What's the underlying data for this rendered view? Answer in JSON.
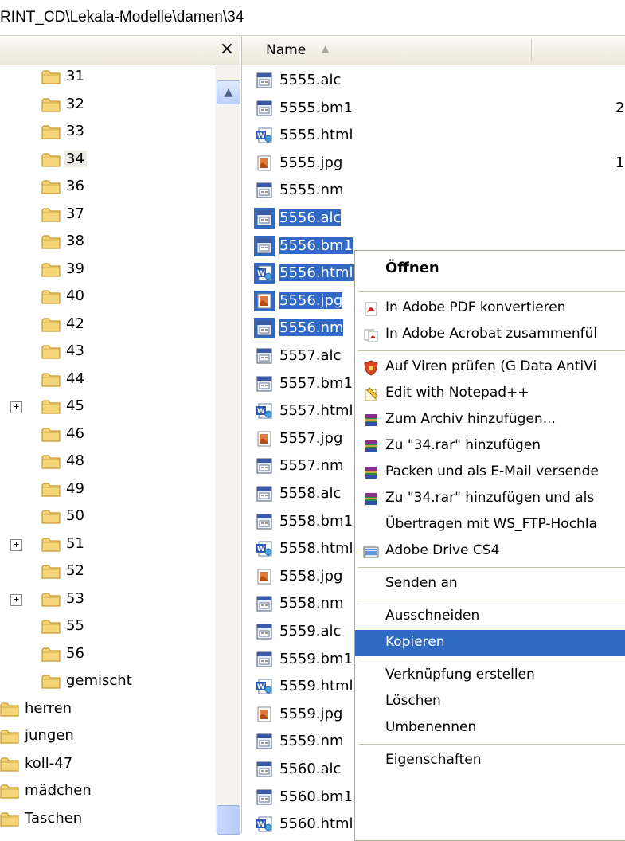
{
  "address": {
    "path": "RINT_CD\\Lekala-Modelle\\damen\\34"
  },
  "folders_pane": {
    "close_label": "×",
    "items": [
      {
        "label": "31",
        "level": 1,
        "expandable": false,
        "selected": false
      },
      {
        "label": "32",
        "level": 1,
        "expandable": false,
        "selected": false
      },
      {
        "label": "33",
        "level": 1,
        "expandable": false,
        "selected": false
      },
      {
        "label": "34",
        "level": 1,
        "expandable": false,
        "selected": true
      },
      {
        "label": "36",
        "level": 1,
        "expandable": false,
        "selected": false
      },
      {
        "label": "37",
        "level": 1,
        "expandable": false,
        "selected": false
      },
      {
        "label": "38",
        "level": 1,
        "expandable": false,
        "selected": false
      },
      {
        "label": "39",
        "level": 1,
        "expandable": false,
        "selected": false
      },
      {
        "label": "40",
        "level": 1,
        "expandable": false,
        "selected": false
      },
      {
        "label": "42",
        "level": 1,
        "expandable": false,
        "selected": false
      },
      {
        "label": "43",
        "level": 1,
        "expandable": false,
        "selected": false
      },
      {
        "label": "44",
        "level": 1,
        "expandable": false,
        "selected": false
      },
      {
        "label": "45",
        "level": 1,
        "expandable": true,
        "selected": false
      },
      {
        "label": "46",
        "level": 1,
        "expandable": false,
        "selected": false
      },
      {
        "label": "48",
        "level": 1,
        "expandable": false,
        "selected": false
      },
      {
        "label": "49",
        "level": 1,
        "expandable": false,
        "selected": false
      },
      {
        "label": "50",
        "level": 1,
        "expandable": false,
        "selected": false
      },
      {
        "label": "51",
        "level": 1,
        "expandable": true,
        "selected": false
      },
      {
        "label": "52",
        "level": 1,
        "expandable": false,
        "selected": false
      },
      {
        "label": "53",
        "level": 1,
        "expandable": true,
        "selected": false
      },
      {
        "label": "55",
        "level": 1,
        "expandable": false,
        "selected": false
      },
      {
        "label": "56",
        "level": 1,
        "expandable": false,
        "selected": false
      },
      {
        "label": "gemischt",
        "level": 1,
        "expandable": false,
        "selected": false
      },
      {
        "label": "herren",
        "level": 0,
        "expandable": false,
        "selected": false
      },
      {
        "label": "jungen",
        "level": 0,
        "expandable": false,
        "selected": false
      },
      {
        "label": "koll-47",
        "level": 0,
        "expandable": false,
        "selected": false
      },
      {
        "label": "mädchen",
        "level": 0,
        "expandable": false,
        "selected": false
      },
      {
        "label": "Taschen",
        "level": 0,
        "expandable": false,
        "selected": false
      }
    ]
  },
  "file_list": {
    "column_name": "Name",
    "files": [
      {
        "name": "5555.alc",
        "icon": "alc-file-icon",
        "selected": false
      },
      {
        "name": "5555.bm1",
        "icon": "bm1-file-icon",
        "selected": false
      },
      {
        "name": "5555.html",
        "icon": "html-file-icon",
        "selected": false
      },
      {
        "name": "5555.jpg",
        "icon": "jpg-file-icon",
        "selected": false
      },
      {
        "name": "5555.nm",
        "icon": "nm-file-icon",
        "selected": false
      },
      {
        "name": "5556.alc",
        "icon": "alc-file-icon",
        "selected": true
      },
      {
        "name": "5556.bm1",
        "icon": "bm1-file-icon",
        "selected": true
      },
      {
        "name": "5556.html",
        "icon": "html-file-icon",
        "selected": true
      },
      {
        "name": "5556.jpg",
        "icon": "jpg-file-icon",
        "selected": true
      },
      {
        "name": "5556.nm",
        "icon": "nm-file-icon",
        "selected": true
      },
      {
        "name": "5557.alc",
        "icon": "alc-file-icon",
        "selected": false
      },
      {
        "name": "5557.bm1",
        "icon": "bm1-file-icon",
        "selected": false
      },
      {
        "name": "5557.html",
        "icon": "html-file-icon",
        "selected": false
      },
      {
        "name": "5557.jpg",
        "icon": "jpg-file-icon",
        "selected": false
      },
      {
        "name": "5557.nm",
        "icon": "nm-file-icon",
        "selected": false
      },
      {
        "name": "5558.alc",
        "icon": "alc-file-icon",
        "selected": false
      },
      {
        "name": "5558.bm1",
        "icon": "bm1-file-icon",
        "selected": false
      },
      {
        "name": "5558.html",
        "icon": "html-file-icon",
        "selected": false
      },
      {
        "name": "5558.jpg",
        "icon": "jpg-file-icon",
        "selected": false
      },
      {
        "name": "5558.nm",
        "icon": "nm-file-icon",
        "selected": false
      },
      {
        "name": "5559.alc",
        "icon": "alc-file-icon",
        "selected": false
      },
      {
        "name": "5559.bm1",
        "icon": "bm1-file-icon",
        "selected": false
      },
      {
        "name": "5559.html",
        "icon": "html-file-icon",
        "selected": false
      },
      {
        "name": "5559.jpg",
        "icon": "jpg-file-icon",
        "selected": false
      },
      {
        "name": "5559.nm",
        "icon": "nm-file-icon",
        "selected": false
      },
      {
        "name": "5560.alc",
        "icon": "alc-file-icon",
        "selected": false
      },
      {
        "name": "5560.bm1",
        "icon": "bm1-file-icon",
        "selected": false
      },
      {
        "name": "5560.html",
        "icon": "html-file-icon",
        "selected": false
      }
    ],
    "partial_size_labels": [
      {
        "text": "2",
        "row": 1
      },
      {
        "text": "1",
        "row": 3
      }
    ]
  },
  "context_menu": {
    "items": [
      {
        "label": "Öffnen",
        "icon": "",
        "bold": true,
        "highlighted": false,
        "separator_after": true
      },
      {
        "label": "In Adobe PDF konvertieren",
        "icon": "adobe-pdf-icon",
        "bold": false,
        "highlighted": false,
        "separator_after": false
      },
      {
        "label": "In Adobe Acrobat zusammenfül",
        "icon": "adobe-acrobat-icon",
        "bold": false,
        "highlighted": false,
        "separator_after": true
      },
      {
        "label": "Auf Viren prüfen (G Data AntiVi",
        "icon": "gdata-shield-icon",
        "bold": false,
        "highlighted": false,
        "separator_after": false
      },
      {
        "label": "Edit with Notepad++",
        "icon": "notepad-plus-icon",
        "bold": false,
        "highlighted": false,
        "separator_after": false
      },
      {
        "label": "Zum Archiv hinzufügen...",
        "icon": "winrar-icon",
        "bold": false,
        "highlighted": false,
        "separator_after": false
      },
      {
        "label": "Zu \"34.rar\" hinzufügen",
        "icon": "winrar-icon",
        "bold": false,
        "highlighted": false,
        "separator_after": false
      },
      {
        "label": "Packen und als E-Mail versende",
        "icon": "winrar-icon",
        "bold": false,
        "highlighted": false,
        "separator_after": false
      },
      {
        "label": "Zu \"34.rar\" hinzufügen und als",
        "icon": "winrar-icon",
        "bold": false,
        "highlighted": false,
        "separator_after": false
      },
      {
        "label": "Übertragen mit WS_FTP-Hochla",
        "icon": "",
        "bold": false,
        "highlighted": false,
        "separator_after": false
      },
      {
        "label": "Adobe Drive CS4",
        "icon": "adobe-drive-icon",
        "bold": false,
        "highlighted": false,
        "separator_after": true
      },
      {
        "label": "Senden an",
        "icon": "",
        "bold": false,
        "highlighted": false,
        "separator_after": true
      },
      {
        "label": "Ausschneiden",
        "icon": "",
        "bold": false,
        "highlighted": false,
        "separator_after": false
      },
      {
        "label": "Kopieren",
        "icon": "",
        "bold": false,
        "highlighted": true,
        "separator_after": true
      },
      {
        "label": "Verknüpfung erstellen",
        "icon": "",
        "bold": false,
        "highlighted": false,
        "separator_after": false
      },
      {
        "label": "Löschen",
        "icon": "",
        "bold": false,
        "highlighted": false,
        "separator_after": false
      },
      {
        "label": "Umbenennen",
        "icon": "",
        "bold": false,
        "highlighted": false,
        "separator_after": true
      },
      {
        "label": "Eigenschaften",
        "icon": "",
        "bold": false,
        "highlighted": false,
        "separator_after": false
      }
    ]
  },
  "colors": {
    "selection": "#316ac5",
    "folder_yellow": "#f5d57a",
    "folder_outline": "#c79a2e"
  }
}
